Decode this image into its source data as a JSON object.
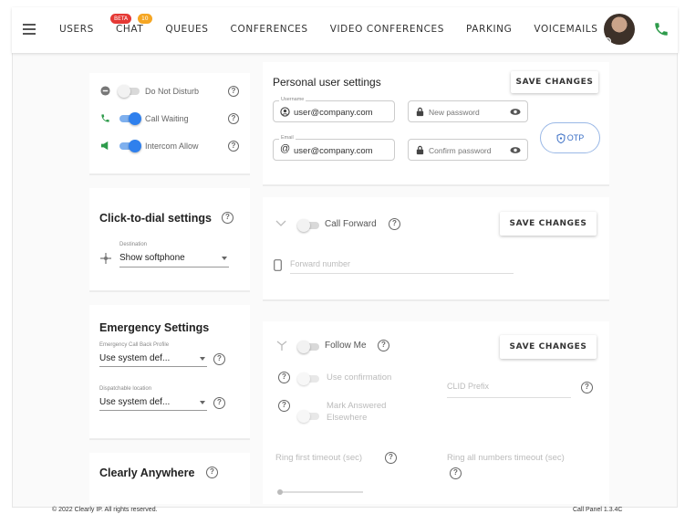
{
  "nav": {
    "items": [
      "USERS",
      "CHAT",
      "QUEUES",
      "CONFERENCES",
      "VIDEO CONFERENCES",
      "PARKING",
      "VOICEMAILS"
    ],
    "chat_badge_beta": "BETA",
    "chat_badge_count": "10"
  },
  "toggles": {
    "dnd": "Do Not Disturb",
    "call_waiting": "Call Waiting",
    "intercom": "Intercom Allow"
  },
  "personal": {
    "title": "Personal user settings",
    "save": "SAVE CHANGES",
    "username_label": "Username",
    "username_value": "user@company.com",
    "email_label": "Email",
    "email_value": "user@company.com",
    "new_password": "New password",
    "confirm_password": "Confirm password",
    "otp": "OTP"
  },
  "click_to_dial": {
    "title": "Click-to-dial settings",
    "destination_label": "Destination",
    "destination_value": "Show softphone"
  },
  "call_forward": {
    "label": "Call Forward",
    "save": "SAVE CHANGES",
    "placeholder": "Forward number"
  },
  "emergency": {
    "title": "Emergency Settings",
    "callback_label": "Emergency Call Back Profile",
    "callback_value": "Use system def...",
    "location_label": "Dispatchable location",
    "location_value": "Use system def..."
  },
  "follow_me": {
    "label": "Follow Me",
    "save": "SAVE CHANGES",
    "use_confirmation": "Use confirmation",
    "mark_answered": "Mark Answered Elsewhere",
    "clid_prefix": "CLID Prefix",
    "ring_first": "Ring first timeout (sec)",
    "ring_all": "Ring all numbers timeout (sec)"
  },
  "clearly_anywhere": {
    "title": "Clearly Anywhere"
  },
  "footer": {
    "copyright": "© 2022 Clearly IP. All rights reserved.",
    "version": "Call Panel 1.3.4C"
  }
}
